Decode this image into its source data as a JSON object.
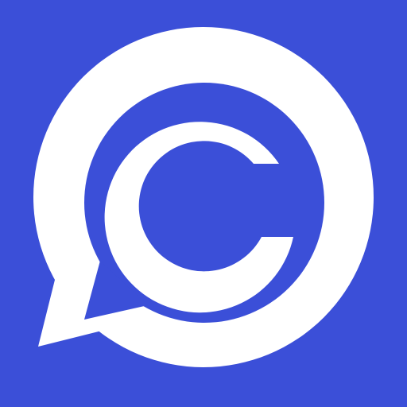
{
  "icon": {
    "name": "chat-bubble-c-logo-icon",
    "background_color": "#3B4FD8",
    "bubble_color": "#FFFFFF",
    "inner_color": "#3B4FD8"
  }
}
